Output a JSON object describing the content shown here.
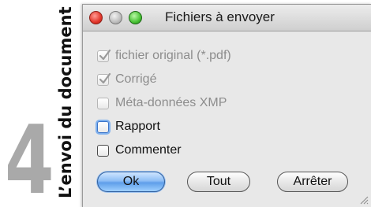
{
  "side": {
    "number": "4",
    "caption": "L’envoi du document"
  },
  "window": {
    "title": "Fichiers à envoyer",
    "options": [
      {
        "label": "fichier original (*.pdf)",
        "checked": true,
        "enabled": false
      },
      {
        "label": "Corrigé",
        "checked": true,
        "enabled": false
      },
      {
        "label": "Méta-données XMP",
        "checked": false,
        "enabled": false
      },
      {
        "label": "Rapport",
        "checked": false,
        "enabled": true,
        "focused": true
      },
      {
        "label": "Commenter",
        "checked": false,
        "enabled": true
      }
    ],
    "buttons": {
      "ok": "Ok",
      "all": "Tout",
      "stop": "Arrêter"
    }
  },
  "colors": {
    "side_number": "#a9a9a9",
    "ok_button": "#6aa6ee",
    "close": "#e2362b",
    "maximize": "#49c235"
  }
}
